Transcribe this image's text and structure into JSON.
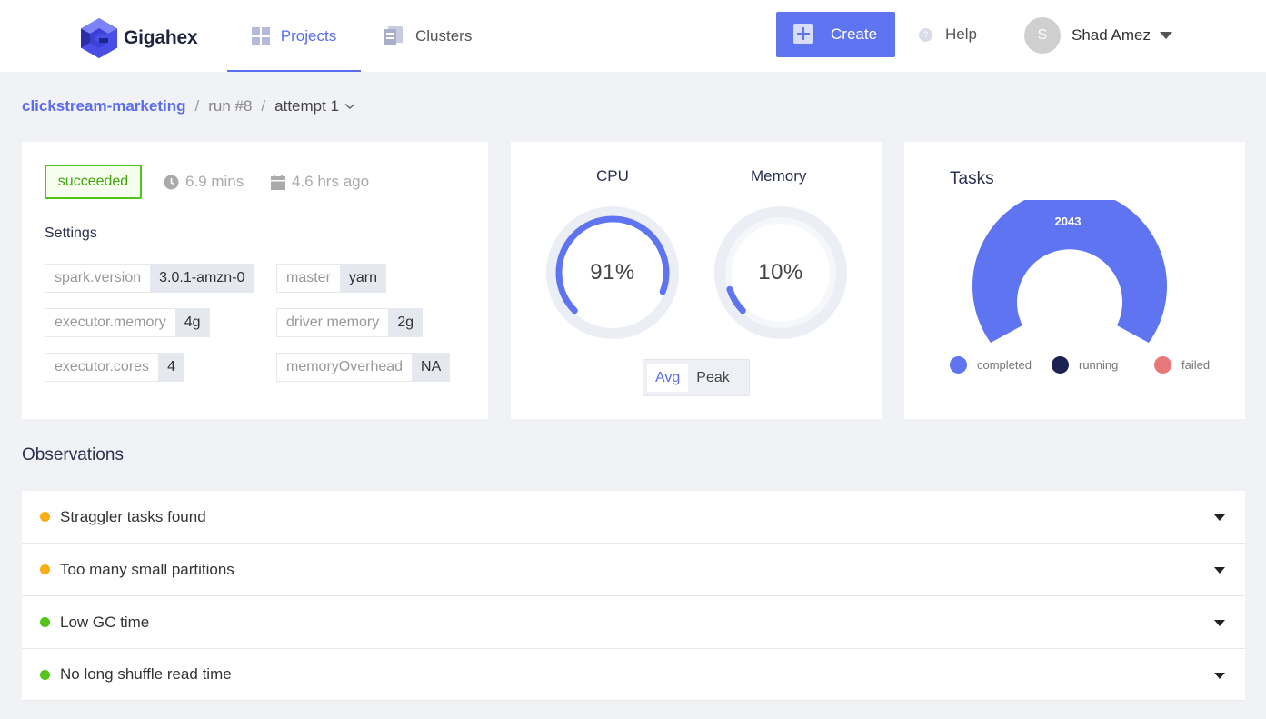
{
  "brand": {
    "name": "Gigahex"
  },
  "nav": {
    "projects": "Projects",
    "clusters": "Clusters"
  },
  "header": {
    "create_label": "Create",
    "help_label": "Help",
    "user_initial": "S",
    "user_name": "Shad Amez"
  },
  "breadcrumb": {
    "project": "clickstream-marketing",
    "sep": "/",
    "run": "run #8",
    "attempt": "attempt 1"
  },
  "run": {
    "status": "succeeded",
    "duration": "6.9 mins",
    "started_ago": "4.6 hrs ago"
  },
  "settings": {
    "title": "Settings",
    "items": [
      {
        "key": "spark.version",
        "value": "3.0.1-amzn-0"
      },
      {
        "key": "master",
        "value": "yarn"
      },
      {
        "key": "executor.memory",
        "value": "4g"
      },
      {
        "key": "driver memory",
        "value": "2g"
      },
      {
        "key": "executor.cores",
        "value": "4"
      },
      {
        "key": "memoryOverhead",
        "value": "NA"
      }
    ]
  },
  "usage": {
    "cpu": {
      "label": "CPU",
      "value_text": "91%",
      "fraction": 0.91
    },
    "memory": {
      "label": "Memory",
      "value_text": "10%",
      "fraction": 0.1
    },
    "toggle": {
      "options": [
        "Avg",
        "Peak"
      ],
      "selected": "Avg"
    }
  },
  "tasks": {
    "title": "Tasks",
    "completed_count": "2043",
    "legend": [
      {
        "label": "completed",
        "color": "#5f74f0"
      },
      {
        "label": "running",
        "color": "#1b2150"
      },
      {
        "label": "failed",
        "color": "#e8777a"
      }
    ]
  },
  "observations": {
    "title": "Observations",
    "items": [
      {
        "label": "Straggler tasks found",
        "status_color": "#faad14"
      },
      {
        "label": "Too many small partitions",
        "status_color": "#faad14"
      },
      {
        "label": "Low GC time",
        "status_color": "#52c41a"
      },
      {
        "label": "No long shuffle read time",
        "status_color": "#52c41a"
      }
    ]
  },
  "colors": {
    "accent": "#5f74f0",
    "success": "#52c41a",
    "warning": "#faad14"
  },
  "icons": [
    "gigahex-logo-icon",
    "grid-icon",
    "server-icon",
    "plus-icon",
    "question-icon",
    "chevron-down-icon",
    "clock-icon",
    "calendar-icon",
    "caret-down-icon"
  ]
}
